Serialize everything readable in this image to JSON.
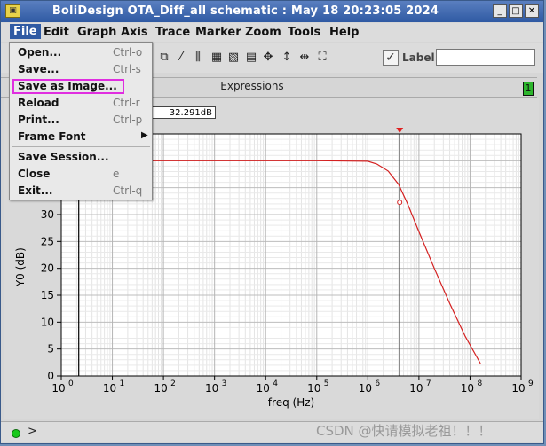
{
  "window": {
    "title": "BoliDesign OTA_Diff_all schematic : May 18 20:23:05 2024"
  },
  "menubar": [
    {
      "label": "File"
    },
    {
      "label": "Edit"
    },
    {
      "label": "Graph"
    },
    {
      "label": "Axis"
    },
    {
      "label": "Trace"
    },
    {
      "label": "Marker"
    },
    {
      "label": "Zoom"
    },
    {
      "label": "Tools"
    },
    {
      "label": "Help"
    }
  ],
  "file_menu": [
    {
      "label": "Open...",
      "shortcut": "Ctrl-o"
    },
    {
      "label": "Save...",
      "shortcut": "Ctrl-s"
    },
    {
      "label": "Save as Image...",
      "shortcut": ""
    },
    {
      "label": "Reload",
      "shortcut": "Ctrl-r"
    },
    {
      "label": "Print...",
      "shortcut": "Ctrl-p"
    },
    {
      "label": "Frame Font",
      "shortcut": ""
    },
    {
      "label": "Save Session...",
      "shortcut": ""
    },
    {
      "label": "Close",
      "shortcut": "e"
    },
    {
      "label": "Exit...",
      "shortcut": "Ctrl-q"
    }
  ],
  "toolbar": {
    "label_text": "Label",
    "label_value": ""
  },
  "expressions": {
    "title": "Expressions",
    "badge": "1"
  },
  "marker": {
    "readout": "32.291dB"
  },
  "status": {
    "prompt": ">"
  },
  "watermark": "CSDN @快请模拟老祖！！！",
  "chart_data": {
    "type": "line",
    "xlabel": "freq (Hz)",
    "ylabel": "Y0 (dB)",
    "xscale": "log",
    "xlim": [
      1,
      1000000000
    ],
    "ylim": [
      0,
      45
    ],
    "x_ticks": [
      {
        "base": "10",
        "exp": "0"
      },
      {
        "base": "10",
        "exp": "1"
      },
      {
        "base": "10",
        "exp": "2"
      },
      {
        "base": "10",
        "exp": "3"
      },
      {
        "base": "10",
        "exp": "4"
      },
      {
        "base": "10",
        "exp": "5"
      },
      {
        "base": "10",
        "exp": "6"
      },
      {
        "base": "10",
        "exp": "7"
      },
      {
        "base": "10",
        "exp": "8"
      },
      {
        "base": "10",
        "exp": "9"
      }
    ],
    "y_ticks": [
      "0",
      "5",
      "10",
      "15",
      "20",
      "25",
      "30"
    ],
    "series": [
      {
        "color": "#d42020",
        "points": [
          [
            1,
            40
          ],
          [
            10,
            40
          ],
          [
            100,
            40
          ],
          [
            1000,
            40
          ],
          [
            10000,
            40
          ],
          [
            100000,
            40
          ],
          [
            1000000,
            39.9
          ],
          [
            1500000,
            39.4
          ],
          [
            2500000,
            38.1
          ],
          [
            4000000,
            35.6
          ],
          [
            6000000,
            32.0
          ],
          [
            10000000,
            26.8
          ],
          [
            20000000,
            20.0
          ],
          [
            40000000,
            13.5
          ],
          [
            80000000,
            7.4
          ],
          [
            160000000,
            2.3
          ]
        ]
      }
    ],
    "cursors": [
      {
        "x": 2.2
      },
      {
        "x": 4200000
      }
    ],
    "marker_point": {
      "x": 4200000,
      "y": 32.291
    }
  }
}
